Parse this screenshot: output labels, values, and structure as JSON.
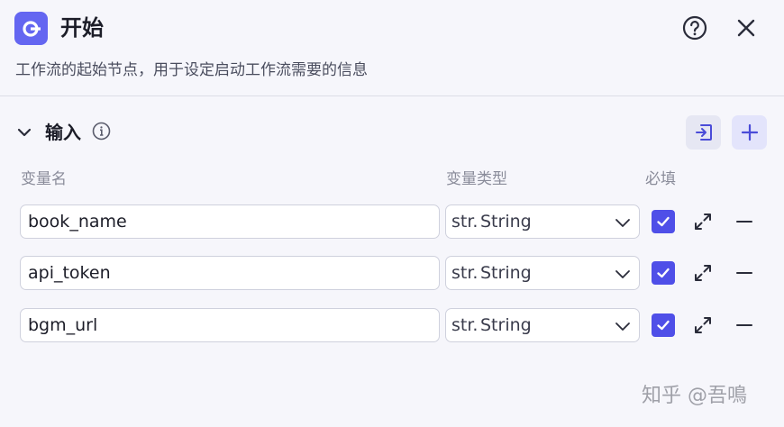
{
  "header": {
    "icon": "start-node-icon",
    "title": "开始",
    "subtitle": "工作流的起始节点，用于设定启动工作流需要的信息",
    "help_icon": "help-circle-icon",
    "close_icon": "close-icon"
  },
  "section": {
    "title": "输入",
    "toggle_icon": "chevron-down-icon",
    "info_icon": "info-icon",
    "import_icon": "import-icon",
    "add_icon": "plus-icon"
  },
  "columns": {
    "name": "变量名",
    "type": "变量类型",
    "required": "必填"
  },
  "rows": [
    {
      "name": "book_name",
      "type_prefix": "str.",
      "type": "String",
      "required": true
    },
    {
      "name": "api_token",
      "type_prefix": "str.",
      "type": "String",
      "required": true
    },
    {
      "name": "bgm_url",
      "type_prefix": "str.",
      "type": "String",
      "required": true
    }
  ],
  "colors": {
    "accent": "#4f4fe8",
    "app_icon_bg": "#6466f1",
    "background": "#f6f6fb"
  },
  "watermark": "知乎 @吾鳴"
}
